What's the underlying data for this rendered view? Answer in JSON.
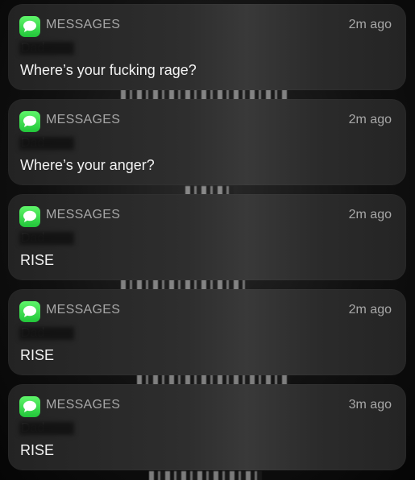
{
  "colors": {
    "background": "#0a0a0a",
    "card": "#2e2e2e",
    "app_icon": "#34d34a",
    "secondary_text": "#a7a7a7",
    "primary_text": "#f2f2f2"
  },
  "notifications": [
    {
      "app": "MESSAGES",
      "time": "2m ago",
      "sender": "Dad",
      "text": "Where’s your fucking rage?",
      "icon": "messages-app-icon"
    },
    {
      "app": "MESSAGES",
      "time": "2m ago",
      "sender": "Dad",
      "text": "Where’s your anger?",
      "icon": "messages-app-icon"
    },
    {
      "app": "MESSAGES",
      "time": "2m ago",
      "sender": "Dad",
      "text": "RISE",
      "icon": "messages-app-icon"
    },
    {
      "app": "MESSAGES",
      "time": "2m ago",
      "sender": "Dad",
      "text": "RISE",
      "icon": "messages-app-icon"
    },
    {
      "app": "MESSAGES",
      "time": "3m ago",
      "sender": "Dad",
      "text": "RISE",
      "icon": "messages-app-icon"
    }
  ]
}
